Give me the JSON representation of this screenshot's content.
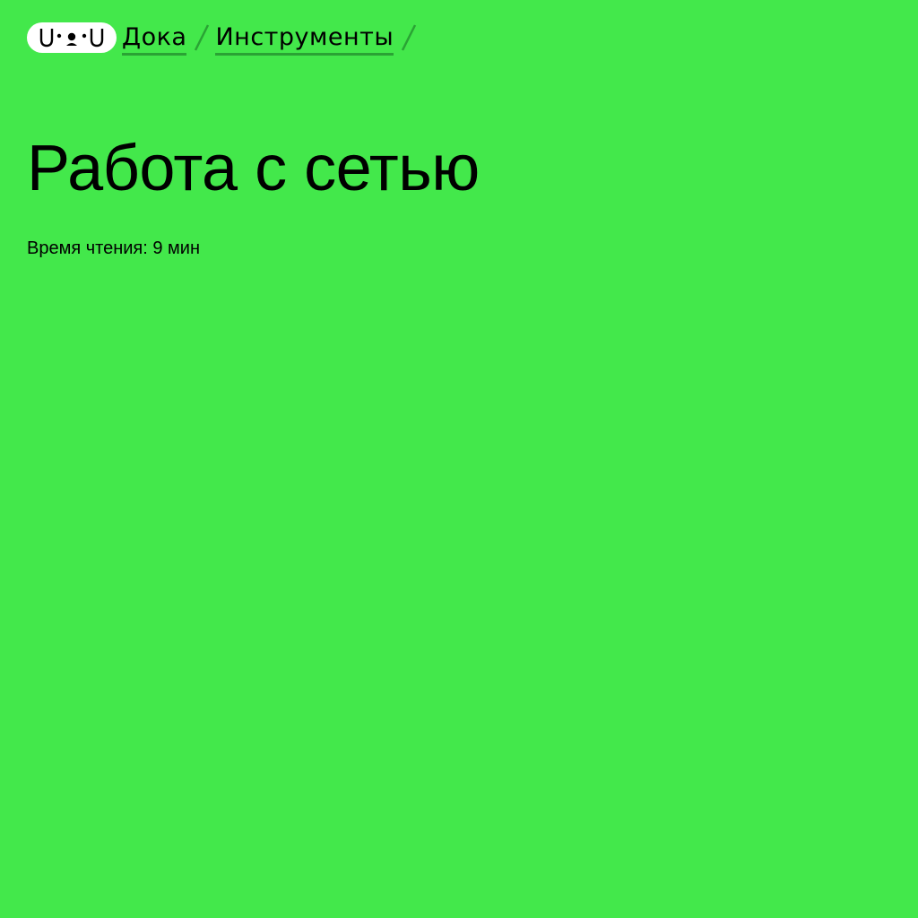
{
  "header": {
    "logo": {
      "icon": "uwu-logo-icon",
      "background": "#ffffff"
    },
    "breadcrumbs": [
      {
        "label": "Дока"
      },
      {
        "label": "Инструменты"
      }
    ],
    "separator_icon": "slash-separator-icon"
  },
  "article": {
    "title": "Работа с сетью",
    "reading_time": "Время чтения: 9 мин"
  },
  "colors": {
    "background": "#43e84b",
    "link_underline": "#2aa334",
    "text": "#000000"
  }
}
